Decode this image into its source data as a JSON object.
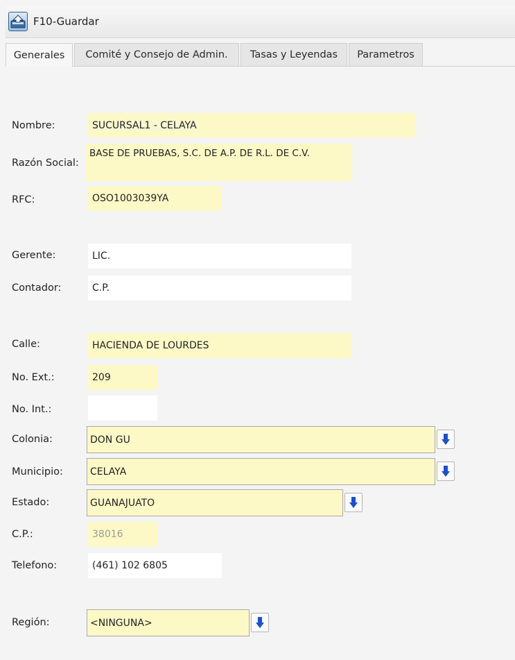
{
  "toolbar": {
    "save_label": "F10-Guardar"
  },
  "tabs": [
    {
      "label": "Generales",
      "active": true
    },
    {
      "label": "Comité y Consejo de Admin."
    },
    {
      "label": "Tasas y Leyendas"
    },
    {
      "label": "Parametros"
    }
  ],
  "form": {
    "nombre": {
      "label": "Nombre:",
      "value": "SUCURSAL1 - CELAYA"
    },
    "razon": {
      "label": "Razón Social:",
      "value": "BASE DE PRUEBAS, S.C. DE A.P. DE R.L. DE C.V."
    },
    "rfc": {
      "label": "RFC:",
      "value": "OSO1003039YA"
    },
    "gerente": {
      "label": "Gerente:",
      "value": "LIC."
    },
    "contador": {
      "label": "Contador:",
      "value": "C.P."
    },
    "calle": {
      "label": "Calle:",
      "value": "HACIENDA DE LOURDES"
    },
    "noext": {
      "label": "No. Ext.:",
      "value": "209"
    },
    "noint": {
      "label": "No. Int.:",
      "value": ""
    },
    "colonia": {
      "label": "Colonia:",
      "value": "DON GU"
    },
    "municipio": {
      "label": "Municipio:",
      "value": "CELAYA"
    },
    "estado": {
      "label": "Estado:",
      "value": "GUANAJUATO"
    },
    "cp": {
      "label": "C.P.:",
      "value": "38016"
    },
    "telefono": {
      "label": "Telefono:",
      "value": "(461) 102 6805"
    },
    "region": {
      "label": "Región:",
      "value": "<NINGUNA>"
    }
  },
  "colors": {
    "field_yellow": "#fdf9c7",
    "dropdown_arrow": "#1a4fd6"
  },
  "icons": {
    "save": "save-drive-icon",
    "dropdown": "down-arrow-icon"
  }
}
